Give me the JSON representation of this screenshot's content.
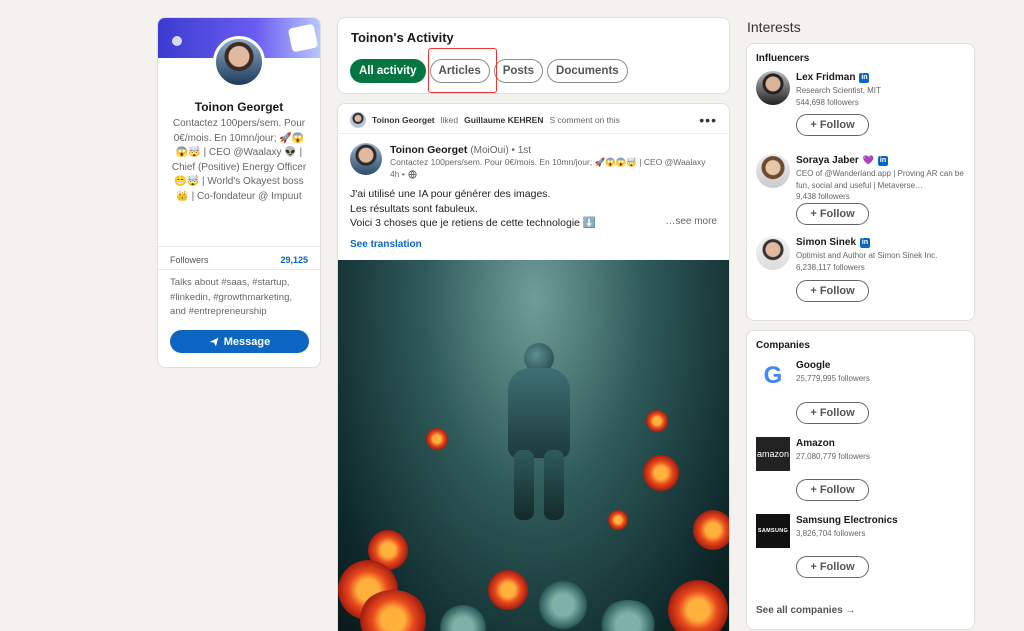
{
  "profile": {
    "name": "Toinon Georget",
    "headline": "Contactez 100pers/sem. Pour 0€/mois. En 10mn/jour; 🚀😱😱🤯 | CEO @Waalaxy 👽 | Chief (Positive) Energy Officer 😁🤯 | World's Okayest boss 👑 | Co-fondateur @ Impuut",
    "followers_label": "Followers",
    "followers_count": "29,125",
    "talks_about": "Talks about #saas, #startup, #linkedin, #growthmarketing, and #entrepreneurship",
    "message_label": "Message"
  },
  "activity": {
    "title": "Toinon's Activity",
    "tabs": [
      "All activity",
      "Articles",
      "Posts",
      "Documents"
    ]
  },
  "post": {
    "liker_name": "Toinon Georget",
    "liked_text": "liked",
    "target_name": "Guillaume KEHREN",
    "comment_text": "S comment on this",
    "author_name": "Toinon Georget",
    "author_pronoun": "(MoiOui) • 1st",
    "author_headline": "Contactez 100pers/sem. Pour 0€/mois. En 10mn/jour; 🚀😱😱🤯 | CEO @Waalaxy",
    "time": "4h •",
    "body_line1": "J'ai utilisé une IA pour générer des images.",
    "body_line2": "Les résultats sont fabuleux.",
    "body_line3": "Voici 3 choses que je retiens de cette technologie ⬇️",
    "see_more": "…see more",
    "see_translation": "See translation"
  },
  "interests": {
    "title": "Interests",
    "influencers_title": "Influencers",
    "influencers": [
      {
        "name": "Lex Fridman",
        "desc": "Research Scientist, MIT",
        "followers": "544,698 followers"
      },
      {
        "name": "Soraya Jaber",
        "desc": "CEO of @Wanderland.app | Proving AR can be fun, social and useful | Metaverse…",
        "followers": "9,438 followers"
      },
      {
        "name": "Simon Sinek",
        "desc": "Optimist and Author at Simon Sinek Inc.",
        "followers": "6,238,117 followers"
      }
    ],
    "companies_title": "Companies",
    "companies": [
      {
        "name": "Google",
        "followers": "25,779,995 followers"
      },
      {
        "name": "Amazon",
        "followers": "27,080,779 followers"
      },
      {
        "name": "Samsung Electronics",
        "followers": "3,826,704 followers"
      }
    ],
    "follow_label": "+ Follow",
    "see_all": "See all companies →"
  },
  "icons": {
    "linkedin_badge": "in",
    "heart": "💜",
    "more": "•••",
    "google_letter": "G",
    "amazon_text": "amazon",
    "samsung_text": "SAMSUNG"
  },
  "colors": {
    "primary": "#0a66c2",
    "active_tab": "#057642",
    "highlight": "#ee3333"
  }
}
